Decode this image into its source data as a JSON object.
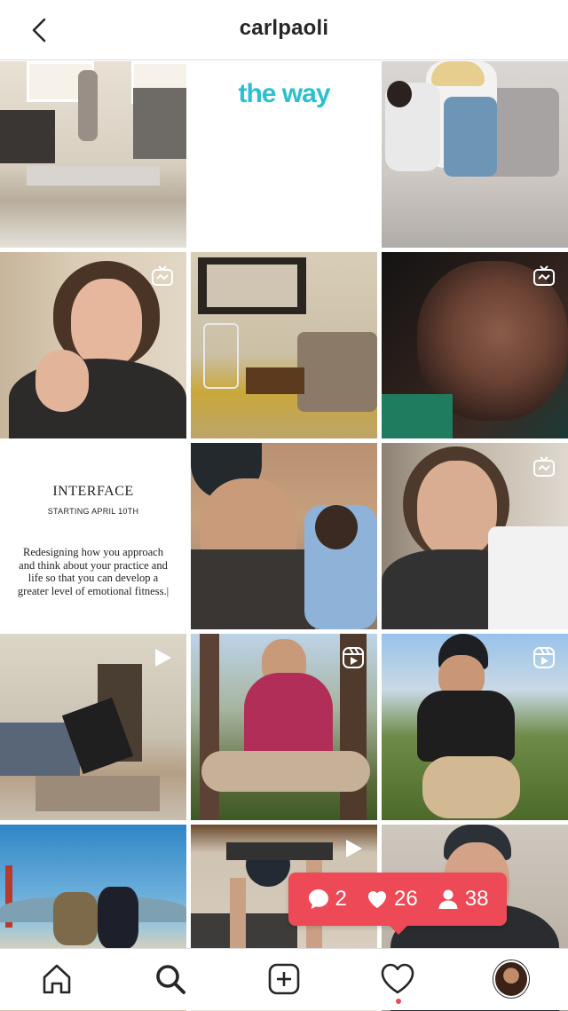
{
  "header": {
    "title": "carlpaoli"
  },
  "grid": {
    "tiles": [
      {
        "name": "post-handstand-room",
        "badge": null
      },
      {
        "name": "post-the-way",
        "text": "the way",
        "badge": null
      },
      {
        "name": "post-mom-baby-sofa",
        "badge": null
      },
      {
        "name": "post-carl-talking",
        "badge": "igtv"
      },
      {
        "name": "post-living-room",
        "badge": null
      },
      {
        "name": "post-fighter-closeup",
        "badge": "igtv"
      },
      {
        "name": "post-interface-text",
        "badge": null,
        "title": "INTERFACE",
        "subtitle": "STARTING APRIL 10TH",
        "body": "Redesigning how you approach and think about your practice and life so that you can develop a greater level of emotional fitness.|"
      },
      {
        "name": "post-selfie-baby",
        "badge": null
      },
      {
        "name": "post-carl-mug",
        "badge": "igtv"
      },
      {
        "name": "post-breakdance-video",
        "badge": "video"
      },
      {
        "name": "post-meditation-reel",
        "badge": "reels"
      },
      {
        "name": "post-crouch-reel",
        "badge": "reels"
      },
      {
        "name": "post-golden-gate",
        "badge": null
      },
      {
        "name": "post-pushup-video",
        "badge": "video"
      },
      {
        "name": "post-cap-smile",
        "badge": null
      }
    ]
  },
  "notification": {
    "comments": "2",
    "likes": "26",
    "followers": "38"
  },
  "nav": {
    "items": [
      "home",
      "search",
      "new-post",
      "activity",
      "profile"
    ]
  },
  "colors": {
    "accent": "#ed4956",
    "theway": "#2bbfd0",
    "border": "#dbdbdb",
    "text": "#262626"
  }
}
